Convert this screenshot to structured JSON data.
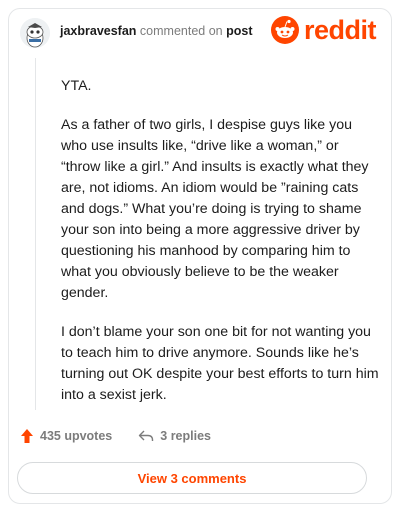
{
  "header": {
    "username": "jaxbravesfan",
    "action_text": "commented on",
    "post_link": "post",
    "brand": "reddit"
  },
  "comment": {
    "paragraphs": [
      "YTA.",
      "As a father of two girls, I despise guys like you who use insults like, “drive like a woman,” or “throw like a girl.” And insults is exactly what they are, not idioms. An idiom would be ”raining cats and dogs.” What you’re doing is trying to shame your son into being a more aggressive driver by questioning his manhood by comparing him to what you obviously believe to be the weaker gender.",
      "I don’t blame your son one bit for not wanting you to teach him to drive anymore. Sounds like he’s turning out OK despite your best efforts to turn him into a sexist jerk."
    ]
  },
  "actions": {
    "upvotes": "435 upvotes",
    "replies": "3 replies"
  },
  "footer": {
    "view_comments": "View 3 comments"
  },
  "colors": {
    "brand": "#ff4500",
    "text": "#1c1c1c",
    "muted": "#7c7c7c",
    "border": "#e4e6e8"
  },
  "icons": [
    "avatar-snoo",
    "reddit-logo-icon",
    "upvote-arrow-icon",
    "reply-arrow-icon"
  ]
}
